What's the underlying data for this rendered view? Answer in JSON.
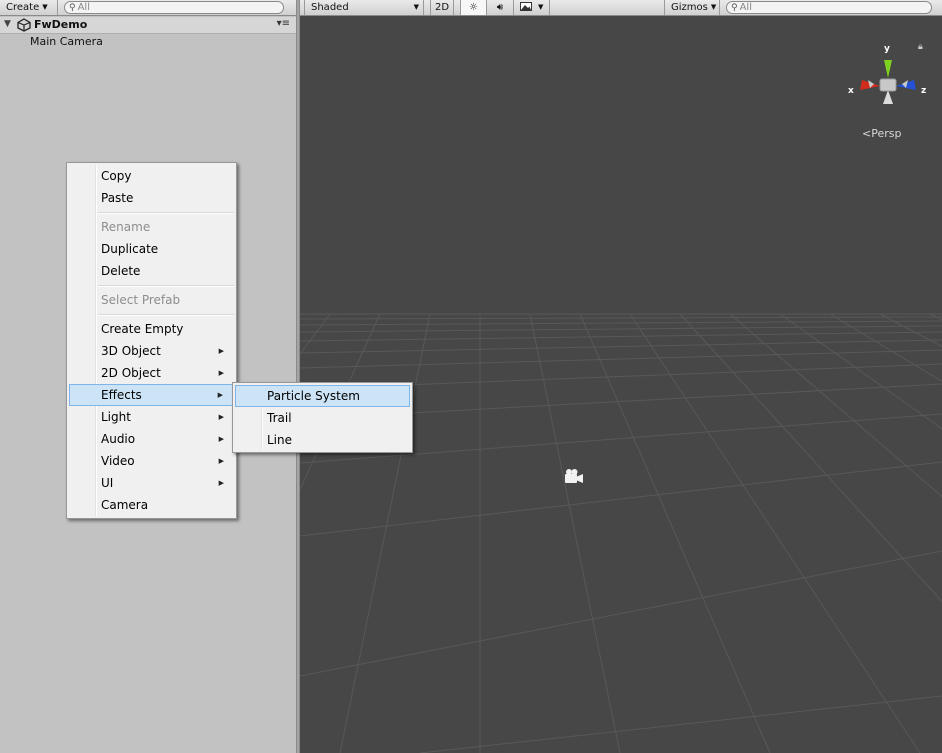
{
  "hierarchy": {
    "create_label": "Create",
    "search_placeholder": "All",
    "scene_name": "FwDemo",
    "items": [
      "Main Camera"
    ]
  },
  "scene_toolbar": {
    "shading_mode": "Shaded",
    "mode_2d_label": "2D",
    "gizmos_label": "Gizmos",
    "search_placeholder": "All"
  },
  "viewport": {
    "projection_label": "Persp",
    "axes": {
      "x": "x",
      "y": "y",
      "z": "z"
    }
  },
  "context_menu": {
    "copy": "Copy",
    "paste": "Paste",
    "rename": "Rename",
    "duplicate": "Duplicate",
    "delete": "Delete",
    "select_prefab": "Select Prefab",
    "create_empty": "Create Empty",
    "object_3d": "3D Object",
    "object_2d": "2D Object",
    "effects": "Effects",
    "light": "Light",
    "audio": "Audio",
    "video": "Video",
    "ui": "UI",
    "camera": "Camera"
  },
  "effects_submenu": {
    "particle_system": "Particle System",
    "trail": "Trail",
    "line": "Line"
  },
  "colors": {
    "panel_bg": "#c2c2c2",
    "scene_bg": "#474747",
    "menu_highlight": "#cde4f7",
    "axis_x": "#d12c1c",
    "axis_y": "#7ed321",
    "axis_z": "#2351d8"
  }
}
